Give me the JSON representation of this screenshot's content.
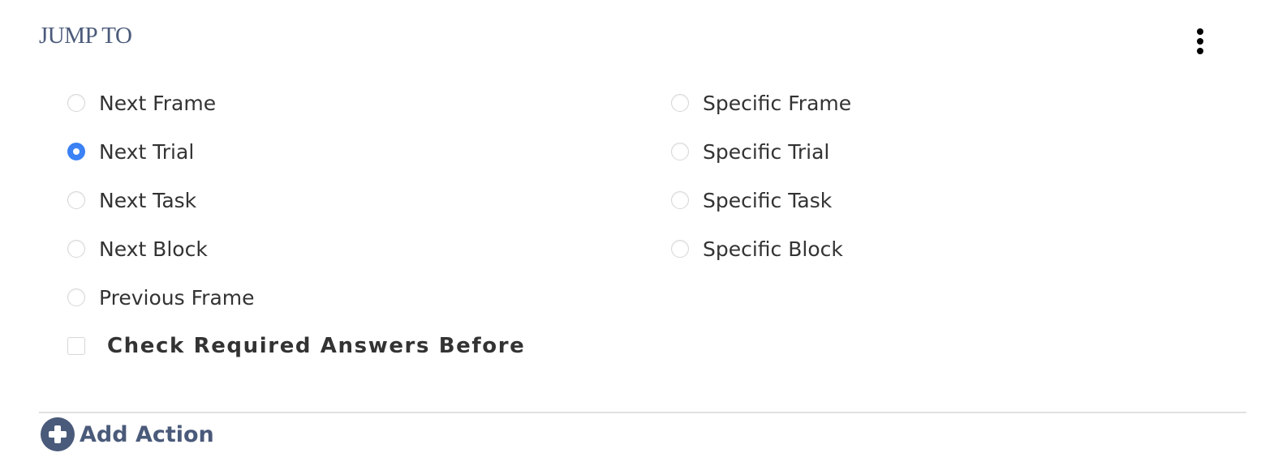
{
  "section": {
    "title": "JUMP TO",
    "menu_icon": "more-vertical-icon"
  },
  "options_left": [
    {
      "label": "Next Frame",
      "checked": false
    },
    {
      "label": "Next Trial",
      "checked": true
    },
    {
      "label": "Next Task",
      "checked": false
    },
    {
      "label": "Next Block",
      "checked": false
    },
    {
      "label": "Previous Frame",
      "checked": false
    }
  ],
  "options_right": [
    {
      "label": "Specific Frame",
      "checked": false
    },
    {
      "label": "Specific Trial",
      "checked": false
    },
    {
      "label": "Specific Task",
      "checked": false
    },
    {
      "label": "Specific Block",
      "checked": false
    }
  ],
  "check_required": {
    "label": "Check Required Answers Before",
    "checked": false
  },
  "add_action": {
    "label": "Add Action",
    "icon": "plus-circle-icon"
  },
  "colors": {
    "accent": "#3b82f6",
    "heading": "#4a5a7a"
  }
}
